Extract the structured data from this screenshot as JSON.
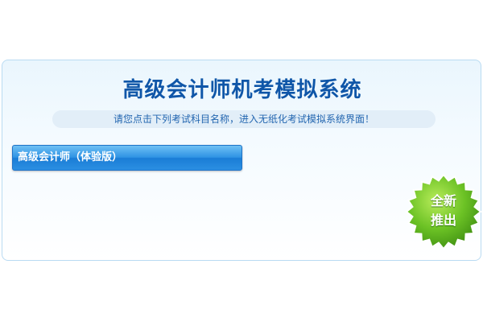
{
  "header": {
    "title": "高级会计师机考模拟系统",
    "subtitle": "请您点击下列考试科目名称，进入无纸化考试模拟系统界面！"
  },
  "exams": [
    {
      "label": "高级会计师（体验版）"
    }
  ],
  "badge": {
    "line1": "全新",
    "line2": "推出",
    "color": "#5fb61e"
  },
  "colors": {
    "title": "#0f56a8",
    "button": "#2f93e4",
    "panel_border": "#b9dbf2"
  }
}
